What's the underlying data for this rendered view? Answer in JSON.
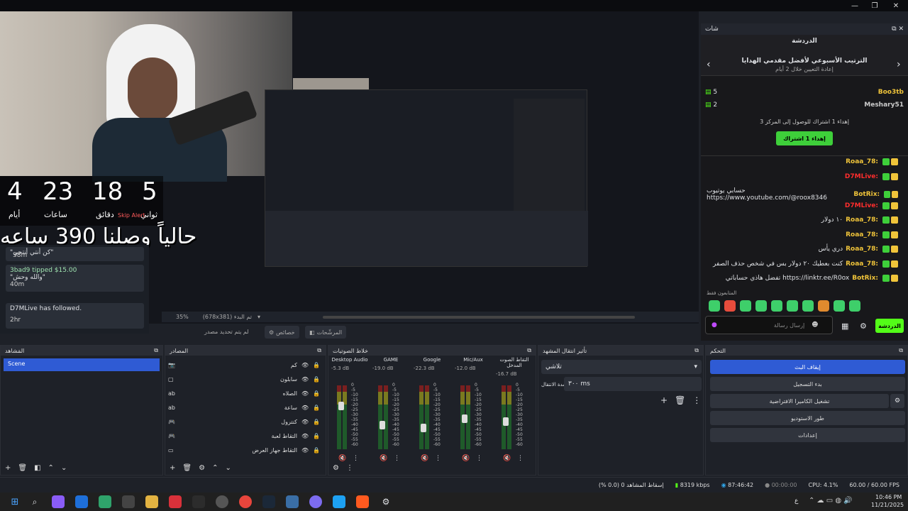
{
  "chat": {
    "header": "شات",
    "title": "الدردشة",
    "leaderboard_title": "الترتيب الأسبوعي لأفضل مقدمي الهدايا",
    "leaderboard_sub": "إعادة التعيين خلال 2 أيام",
    "leaders": [
      {
        "name": "Boo3tb",
        "count": "5"
      },
      {
        "name": "Meshary51",
        "count": "2"
      }
    ],
    "gift_info": "إهداء 1 اشتراك للوصول إلى المركز 3",
    "gift_button": "إهداء 1 اشتراك",
    "messages": [
      {
        "user": "Roaa_78:",
        "text": "",
        "color": "#f0c43a"
      },
      {
        "user": "D7MLive:",
        "text": "",
        "color": "#ff2d2d"
      },
      {
        "user": "BotRix:",
        "text": "حسابي يوتيوب https://www.youtube.com/@roox8346",
        "color": "#f0c43a"
      },
      {
        "user": "D7MLive:",
        "text": "",
        "color": "#ff2d2d"
      },
      {
        "user": "Roaa_78:",
        "text": "١٠ دولار",
        "color": "#f0c43a"
      },
      {
        "user": "Roaa_78:",
        "text": "",
        "color": "#f0c43a"
      },
      {
        "user": "Roaa_78:",
        "text": "دري يأس",
        "color": "#f0c43a"
      },
      {
        "user": "Roaa_78:",
        "text": "كنت بعطيك ٢٠ دولار بس في شخص حذف الصفر",
        "color": "#f0c43a"
      },
      {
        "user": "BotRix:",
        "text": "تفضل هاذي حساباتي https://linktr.ee/R0ox",
        "color": "#f0c43a"
      }
    ],
    "followers_only": "المتابعون فقط",
    "input_placeholder": "إرسال رسالة",
    "send_button": "الدردشة"
  },
  "overlay": {
    "countdown": {
      "days": "4",
      "hours": "23",
      "minutes": "18",
      "seconds": "5"
    },
    "units": {
      "days": "أيام",
      "hours": "ساعات",
      "minutes": "دقائق",
      "seconds": "ثواني"
    },
    "skip_alert": "Skip Alert",
    "big_text": "حالياً وصلنا 390 ساعه",
    "alerts": [
      {
        "title": "\"كن أنتي أنتحي\"",
        "time": "38m"
      },
      {
        "title": "3bad9 tipped $15.00",
        "sub": "\"والله وحش\"",
        "time": "40m"
      },
      {
        "title": "D7MLive has followed.",
        "time": "2hr"
      }
    ]
  },
  "canvas": {
    "zoom": "35%",
    "resolution": "(678x381) تم البدء",
    "no_source": "لم يتم تحديد مصدر",
    "properties": "خصائص",
    "filters": "المرشّحات"
  },
  "scenes": {
    "title": "المَشاهد",
    "items": [
      "Scene"
    ]
  },
  "sources": {
    "title": "المصادر",
    "items": [
      {
        "name": "كم"
      },
      {
        "name": "سابلون"
      },
      {
        "name": "الصلاه"
      },
      {
        "name": "ساعة"
      },
      {
        "name": "كنترول"
      },
      {
        "name": "التقاط لعبة"
      },
      {
        "name": "التقاط جهاز العرض"
      }
    ]
  },
  "mixer": {
    "title": "خلاط الصوتيات",
    "channels": [
      {
        "name": "Desktop Audio",
        "db": "-5.3 dB",
        "level": 0.75
      },
      {
        "name": "GAME",
        "db": "-19.0 dB",
        "level": 0.45
      },
      {
        "name": "Google",
        "db": "-22.3 dB",
        "level": 0.4
      },
      {
        "name": "Mic/Aux",
        "db": "-12.0 dB",
        "level": 0.55
      },
      {
        "name": "التقاط الصوت المدخل",
        "db": "-16.7 dB",
        "level": 0.5
      }
    ],
    "scale": [
      "0",
      "-5",
      "-10",
      "-15",
      "-20",
      "-25",
      "-30",
      "-35",
      "-40",
      "-45",
      "-50",
      "-55",
      "-60"
    ]
  },
  "transitions": {
    "title": "تأثير انتقال المشهد",
    "selected": "تلاشي",
    "duration_label": "مدة الانتقال",
    "duration": "٣٠٠ ms"
  },
  "controls": {
    "title": "التحكم",
    "buttons": [
      "إيقاف البث",
      "بدء التسجيل",
      "تشغيل الكاميرا الافتراضية",
      "طور الاستوديو",
      "إعدادات"
    ]
  },
  "status": {
    "dropped": "إسقاط المشاهد 0 (0.0 %)",
    "bitrate": "8319 kbps",
    "live_time": "87:46:42",
    "rec_time": "00:00:00",
    "cpu": "CPU: 4.1%",
    "fps": "60.00 / 60.00 FPS"
  },
  "taskbar": {
    "lang": "ع",
    "time": "10:46 PM",
    "date": "11/21/2025"
  },
  "colors": {
    "accent": "#2f5bd4",
    "kick_green": "#53fc18",
    "live_red": "#ff2d2d"
  }
}
